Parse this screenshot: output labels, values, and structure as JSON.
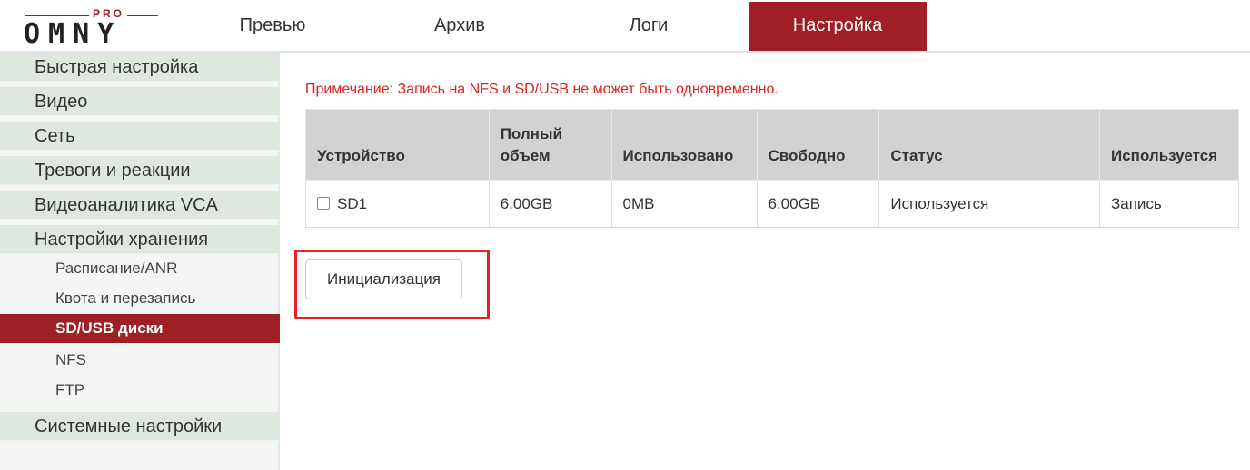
{
  "logo": {
    "top": "PRO",
    "word": "OMNY"
  },
  "nav": {
    "tabs": [
      {
        "label": "Превью"
      },
      {
        "label": "Архив"
      },
      {
        "label": "Логи"
      },
      {
        "label": "Настройка",
        "active": true
      }
    ]
  },
  "sidebar": {
    "items": [
      {
        "label": "Быстрая настройка"
      },
      {
        "label": "Видео"
      },
      {
        "label": "Сеть"
      },
      {
        "label": "Тревоги и реакции"
      },
      {
        "label": "Видеоаналитика VCA"
      },
      {
        "label": "Настройки хранения"
      }
    ],
    "subitems": [
      {
        "label": "Расписание/ANR"
      },
      {
        "label": "Квота и перезапись"
      },
      {
        "label": "SD/USB диски",
        "active": true
      },
      {
        "label": "NFS"
      },
      {
        "label": "FTP"
      }
    ],
    "last_item": {
      "label": "Системные настройки"
    }
  },
  "main": {
    "note": "Примечание: Запись на NFS и SD/USB не может быть одновременно.",
    "table": {
      "headers": {
        "device": "Устройство",
        "total_line1": "Полный",
        "total_line2": "объем",
        "used": "Использовано",
        "free": "Свободно",
        "status": "Статус",
        "usage": "Используется"
      },
      "rows": [
        {
          "device": "SD1",
          "total": "6.00GB",
          "used": "0MB",
          "free": "6.00GB",
          "status": "Используется",
          "usage": "Запись"
        }
      ]
    },
    "init_button": "Инициализация"
  },
  "colors": {
    "accent": "#9e1f24",
    "note": "#e02020",
    "highlight": "#ee1c24"
  }
}
